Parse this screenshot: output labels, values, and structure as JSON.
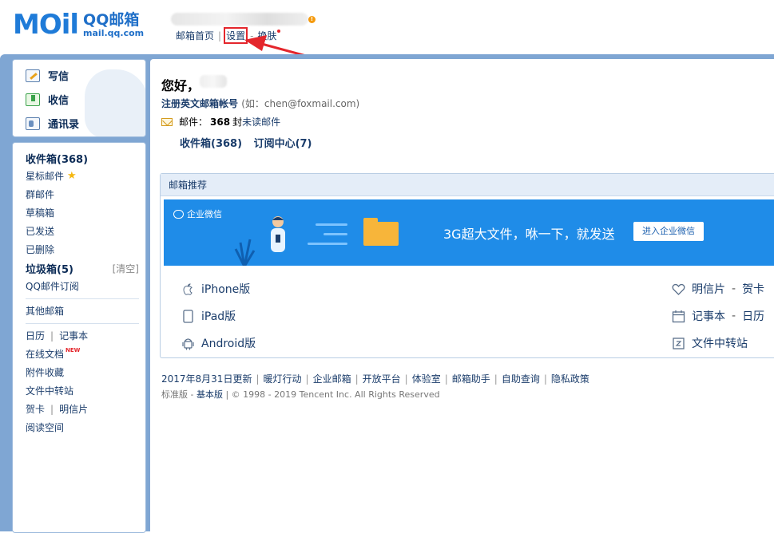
{
  "header": {
    "logo_word": "MOil",
    "logo_cn": "QQ邮箱",
    "logo_url": "mail.qq.com",
    "top_links": [
      "邮箱首页",
      "设置",
      "换肤"
    ],
    "notice_badge": "!"
  },
  "sidebar": {
    "actions": [
      {
        "label": "写信",
        "icon": "pencil-paper-icon"
      },
      {
        "label": "收信",
        "icon": "download-tray-icon"
      },
      {
        "label": "通讯录",
        "icon": "contact-card-icon"
      }
    ],
    "folders": {
      "inbox": "收件箱(368)",
      "starred": "星标邮件",
      "group": "群邮件",
      "drafts": "草稿箱",
      "sent": "已发送",
      "deleted": "已删除",
      "spam": "垃圾箱(5)",
      "spam_clear": "[清空]",
      "subscriptions": "QQ邮件订阅",
      "other": "其他邮箱",
      "calendar": "日历",
      "notes": "记事本",
      "docs": "在线文档",
      "docs_badge": "NEW",
      "attachments": "附件收藏",
      "transfer": "文件中转站",
      "greeting": "贺卡",
      "postcard": "明信片",
      "reading": "阅读空间"
    }
  },
  "main": {
    "greeting": "您好，",
    "register_link": "注册英文邮箱帐号",
    "register_hint": "(如：chen@foxmail.com)",
    "mail_label": "邮件：",
    "mail_count": "368",
    "mail_unit": "封",
    "unread_link": "未读邮件",
    "inbox_link": "收件箱(368)",
    "subscribe_link": "订阅中心(7)",
    "recommend": {
      "title": "邮箱推荐",
      "banner_brand": "企业微信",
      "banner_text": "3G超大文件，咻一下，就发送",
      "banner_button": "进入企业微信",
      "apps_left": [
        "iPhone版",
        "iPad版",
        "Android版"
      ],
      "apps_right": [
        {
          "a": "明信片",
          "b": "贺卡"
        },
        {
          "a": "记事本",
          "b": "日历"
        },
        {
          "a": "文件中转站",
          "b": ""
        }
      ]
    },
    "footer_links": [
      "2017年8月31日更新",
      "暖灯行动",
      "企业邮箱",
      "开放平台",
      "体验室",
      "邮箱助手",
      "自助查询",
      "隐私政策"
    ],
    "copyright_prefix": "标准版",
    "copyright_link": "基本版",
    "copyright_text": "© 1998 - 2019 Tencent Inc. All Rights Reserved"
  },
  "colors": {
    "frame": "#7fa6d3",
    "banner": "#1f8ce8",
    "annotation": "#e4262c"
  }
}
